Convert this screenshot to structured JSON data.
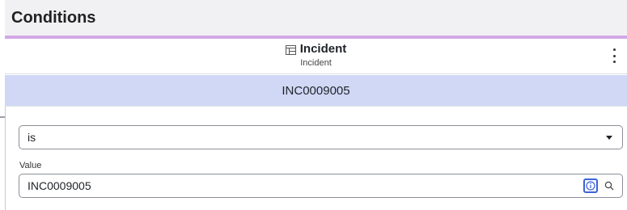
{
  "header": {
    "title": "Conditions"
  },
  "table": {
    "title": "Incident",
    "subtitle": "Incident",
    "icon": "table-icon",
    "menu_icon": "more-vertical-icon"
  },
  "selected_row": {
    "value": "INC0009005"
  },
  "condition": {
    "operator": "is",
    "value_label": "Value",
    "value": "INC0009005",
    "info_icon": "info-icon",
    "search_icon": "search-icon"
  },
  "colors": {
    "header_bg": "#f1f1f3",
    "accent_line": "#d2a8e6",
    "highlight_row": "#d0d8f6",
    "info_border": "#3b63d9"
  }
}
